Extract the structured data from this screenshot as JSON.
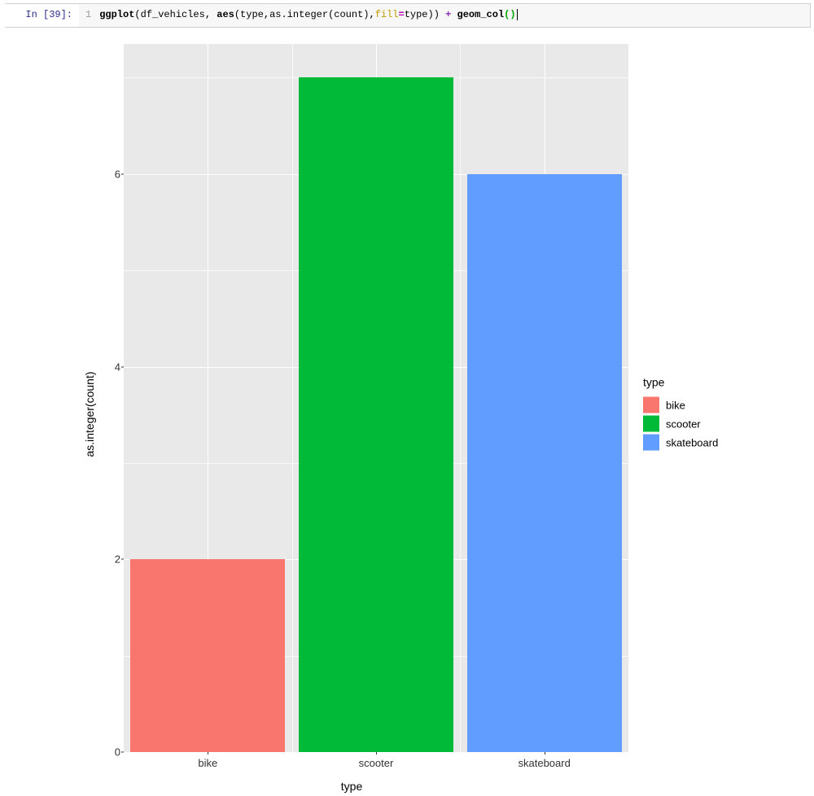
{
  "cell": {
    "prompt": "In [39]:",
    "lineno": "1",
    "code": [
      {
        "t": "ggplot",
        "c": "tk-fn"
      },
      {
        "t": "(df_vehicles, ",
        "c": ""
      },
      {
        "t": "aes",
        "c": "tk-fn"
      },
      {
        "t": "(type,as.integer(count),",
        "c": ""
      },
      {
        "t": "fill",
        "c": "tk-arg"
      },
      {
        "t": "=",
        "c": "tk-kw"
      },
      {
        "t": "type)) ",
        "c": ""
      },
      {
        "t": "+",
        "c": "tk-op"
      },
      {
        "t": " ",
        "c": ""
      },
      {
        "t": "geom_col",
        "c": "tk-fn"
      },
      {
        "t": "()",
        "c": "tk-par"
      }
    ]
  },
  "chart_data": {
    "type": "bar",
    "categories": [
      "bike",
      "scooter",
      "skateboard"
    ],
    "values": [
      2,
      7,
      6
    ],
    "colors": [
      "#f8766d",
      "#00ba38",
      "#619cff"
    ],
    "xlabel": "type",
    "ylabel": "as.integer(count)",
    "ylim": [
      0,
      7
    ],
    "yticks": [
      0,
      2,
      4,
      6
    ],
    "legend_title": "type",
    "legend": [
      {
        "label": "bike",
        "color": "#f8766d"
      },
      {
        "label": "scooter",
        "color": "#00ba38"
      },
      {
        "label": "skateboard",
        "color": "#619cff"
      }
    ]
  }
}
